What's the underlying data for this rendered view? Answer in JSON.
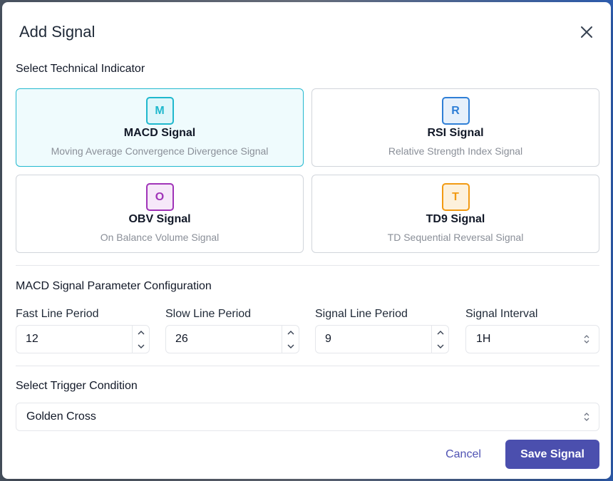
{
  "dialog": {
    "title": "Add Signal"
  },
  "indicator_section": {
    "title": "Select Technical Indicator",
    "options": [
      {
        "letter": "M",
        "name": "MACD Signal",
        "description": "Moving Average Convergence Divergence Signal",
        "color": "#1fb8cd",
        "selected": true
      },
      {
        "letter": "R",
        "name": "RSI Signal",
        "description": "Relative Strength Index Signal",
        "color": "#2f7fd6",
        "selected": false
      },
      {
        "letter": "O",
        "name": "OBV Signal",
        "description": "On Balance Volume Signal",
        "color": "#a033b8",
        "selected": false
      },
      {
        "letter": "T",
        "name": "TD9 Signal",
        "description": "TD Sequential Reversal Signal",
        "color": "#f29a12",
        "selected": false
      }
    ]
  },
  "params_section": {
    "title": "MACD Signal Parameter Configuration",
    "fast_label": "Fast Line Period",
    "fast_value": "12",
    "slow_label": "Slow Line Period",
    "slow_value": "26",
    "signal_label": "Signal Line Period",
    "signal_value": "9",
    "interval_label": "Signal Interval",
    "interval_value": "1H"
  },
  "trigger_section": {
    "title": "Select Trigger Condition",
    "value": "Golden Cross"
  },
  "footer": {
    "cancel_label": "Cancel",
    "save_label": "Save Signal"
  },
  "colors": {
    "accent": "#4b4fae",
    "selected_border": "#22b8cf"
  }
}
